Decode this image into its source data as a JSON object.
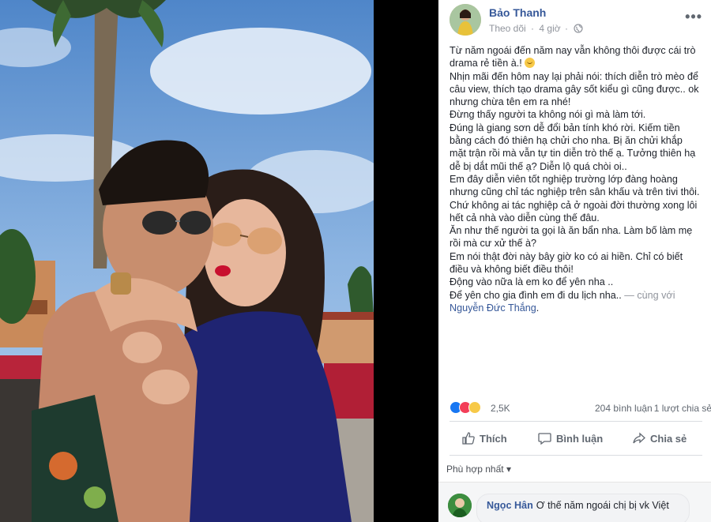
{
  "post": {
    "author": "Bảo Thanh",
    "follow_label": "Theo dõi",
    "time": "4 giờ",
    "separator": "·",
    "lines": [
      "Từ năm ngoái đến năm nay vẫn không thôi được cái trò drama rẻ tiền à.!",
      "Nhịn mãi đến hôm nay lại phải nói: thích diễn trò mèo để câu view, thích tạo drama gây sốt kiểu gì cũng được.. ok nhưng chừa tên em ra nhé!",
      "Đừng thấy người ta không nói gì mà làm tới.",
      "Đúng là giang sơn dễ đổi bản tính khó rời. Kiếm tiền bằng cách đó thiên hạ chửi cho nha. Bị ăn chửi khắp mặt trận rồi mà vẫn tự tin diễn trò thế ạ. Tưởng thiên hạ dễ bị dắt mũi thế ạ? Diễn lộ quá chòi oi..",
      "Em đây diễn viên tốt nghiệp trường lớp đàng hoàng nhưng cũng chỉ tác nghiệp trên sân khấu và trên tivi thôi. Chứ không ai tác nghiệp cả ở ngoài đời thường xong lôi hết cả nhà vào diễn cùng thế đâu.",
      "Ăn như thế người ta gọi là ăn bẩn nha. Làm bố làm mẹ rồi mà cư xử thế à?",
      "Em nói thật đời này bây giờ ko có ai hiền. Chỉ có biết điều và không biết điều thôi!",
      "Động vào nữa là em ko để yên nha ..",
      "Để yên cho gia đình em đi du lịch nha.."
    ],
    "with_text": "— cùng với",
    "tagged": "Nguyễn Đức Thắng",
    "tagged_suffix": "."
  },
  "stats": {
    "reactions": "2,5K",
    "comments": "204 bình luận",
    "shares": "1 lượt chia sẻ"
  },
  "actions": {
    "like": "Thích",
    "comment": "Bình luận",
    "share": "Chia sẻ"
  },
  "sort": {
    "label": "Phù hợp nhất",
    "arrow": "▾"
  },
  "comment": {
    "name": "Ngọc Hân",
    "text": "Ơ thế năm ngoái chị bị vk Việt"
  },
  "colors": {
    "link": "#365899",
    "meta": "#90949c",
    "like": "#1877f2",
    "love": "#f33e58",
    "haha": "#f7c948"
  },
  "icons": [
    "more-icon",
    "globe-icon",
    "like-icon",
    "comment-icon",
    "share-icon",
    "smile-emoji-icon"
  ]
}
